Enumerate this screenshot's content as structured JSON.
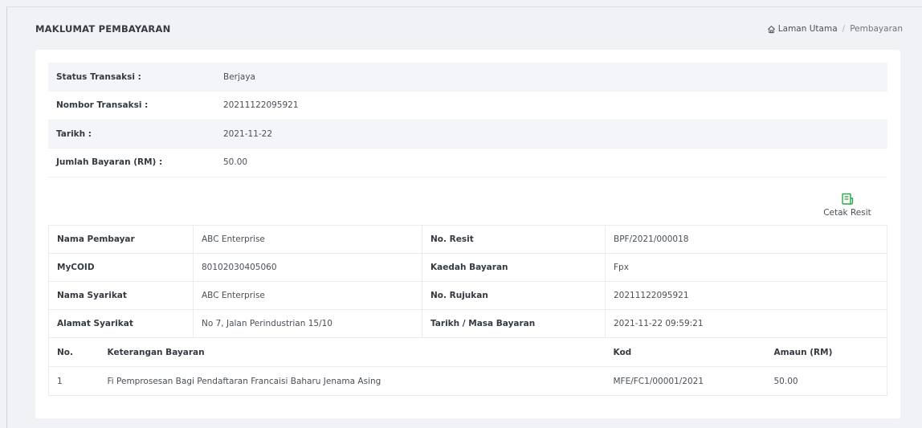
{
  "page": {
    "title": "MAKLUMAT PEMBAYARAN",
    "breadcrumb": [
      {
        "label": "Laman Utama",
        "icon": "home-icon"
      },
      {
        "label": "Pembayaran"
      }
    ]
  },
  "status": [
    {
      "label": "Status Transaksi :",
      "value": "Berjaya"
    },
    {
      "label": "Nombor Transaksi :",
      "value": "20211122095921"
    },
    {
      "label": "Tarikh :",
      "value": "2021-11-22"
    },
    {
      "label": "Jumlah Bayaran (RM) :",
      "value": "50.00"
    }
  ],
  "print_receipt": {
    "label": "Cetak Resit",
    "icon": "receipt-icon",
    "color": "#28a745"
  },
  "info": [
    {
      "label1": "Nama Pembayar",
      "value1": "ABC Enterprise",
      "label2": "No. Resit",
      "value2": "BPF/2021/000018"
    },
    {
      "label1": "MyCOID",
      "value1": "80102030405060",
      "label2": "Kaedah Bayaran",
      "value2": "Fpx"
    },
    {
      "label1": "Nama Syarikat",
      "value1": "ABC Enterprise",
      "label2": "No. Rujukan",
      "value2": "20211122095921"
    },
    {
      "label1": "Alamat Syarikat",
      "value1": "No 7, Jalan Perindustrian 15/10",
      "label2": "Tarikh / Masa Bayaran",
      "value2": "2021-11-22 09:59:21"
    }
  ],
  "fees": {
    "headers": [
      "No.",
      "Keterangan Bayaran",
      "Kod",
      "Amaun (RM)"
    ],
    "rows": [
      [
        "1",
        "Fi Pemprosesan Bagi Pendaftaran Francaisi Baharu Jenama Asing",
        "MFE/FC1/00001/2021",
        "50.00"
      ]
    ]
  }
}
